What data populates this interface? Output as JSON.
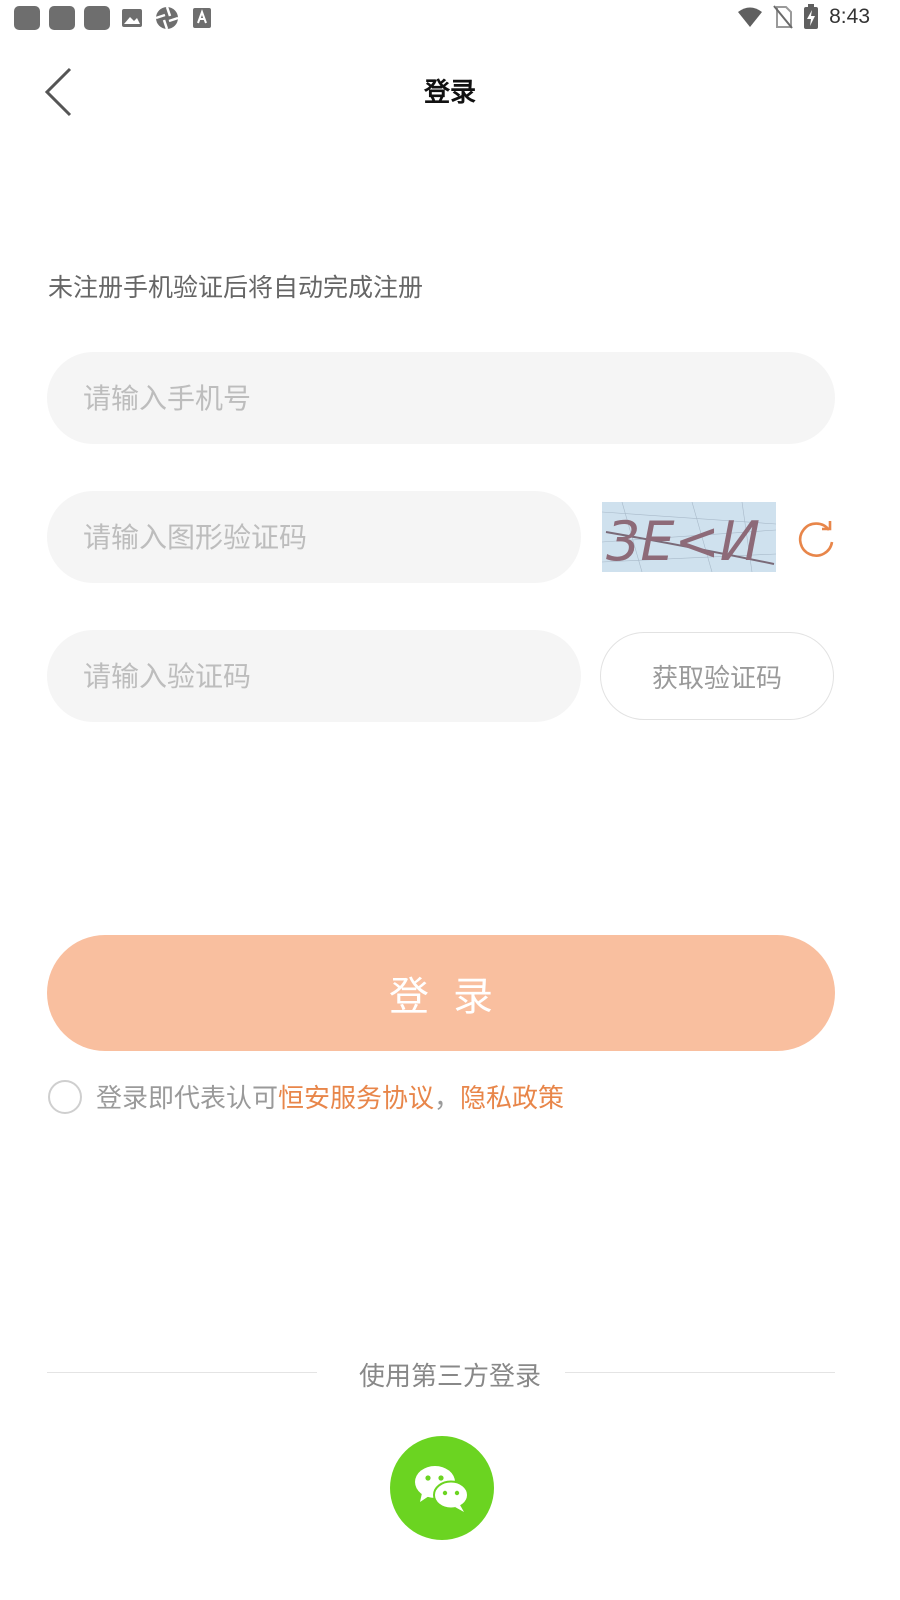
{
  "status_bar": {
    "time": "8:43",
    "left_icons": [
      "app-square-icon",
      "app-square-icon",
      "app-square-icon",
      "image-icon",
      "aperture-icon",
      "font-a-icon"
    ],
    "right_icons": [
      "wifi-icon",
      "no-sim-icon",
      "battery-charging-icon"
    ]
  },
  "header": {
    "title": "登录",
    "back_icon": "chevron-left-icon"
  },
  "form": {
    "hint": "未注册手机验证后将自动完成注册",
    "phone_placeholder": "请输入手机号",
    "captcha_placeholder": "请输入图形验证码",
    "captcha_text": "3E<И",
    "refresh_icon": "refresh-icon",
    "sms_placeholder": "请输入验证码",
    "get_code_label": "获取验证码",
    "login_label": "登录"
  },
  "agreement": {
    "prefix": "登录即代表认可",
    "service_link": "恒安服务协议",
    "separator": "，",
    "privacy_link": "隐私政策"
  },
  "third_party": {
    "label": "使用第三方登录",
    "wechat_icon": "wechat-icon"
  },
  "colors": {
    "accent": "#e8864a",
    "login_button": "#f9bf9f",
    "wechat": "#6bd421",
    "field_bg": "#f5f5f5"
  }
}
